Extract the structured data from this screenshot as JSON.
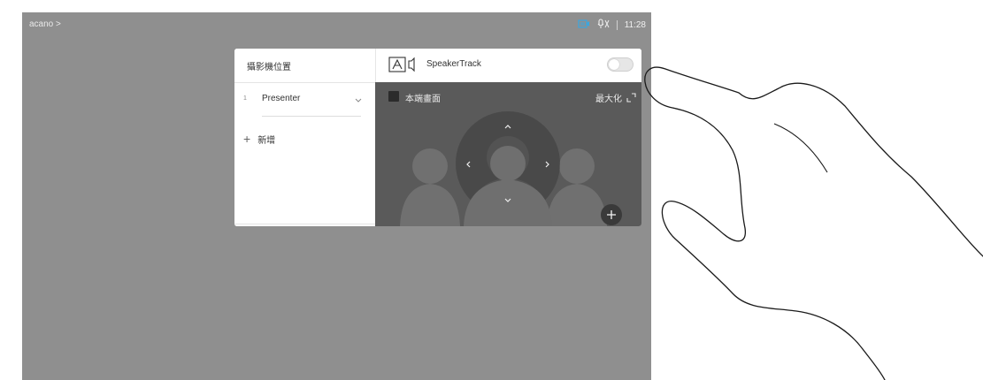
{
  "status_bar": {
    "breadcrumb": "acano >",
    "time": "11:28",
    "icons": [
      "camera-icon",
      "microphone-muted-icon"
    ]
  },
  "camera_panel": {
    "title": "攝影機位置",
    "presets": [
      {
        "number": "1",
        "name": "Presenter"
      }
    ],
    "add_label": "新增",
    "speakertrack": {
      "label": "SpeakerTrack",
      "enabled": false
    },
    "selfview_label": "本端畫面",
    "maximize_label": "最大化"
  },
  "colors": {
    "screen_bg": "#8f8f8f",
    "camera_view_bg": "#5a5a5a",
    "status_icon_accent": "#3aa7e0"
  }
}
